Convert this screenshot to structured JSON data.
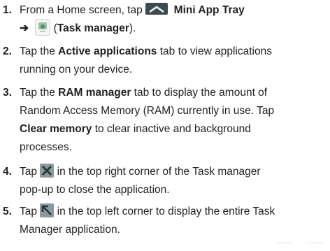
{
  "steps": [
    {
      "number": "1.",
      "line1_before": "From a Home screen, tap ",
      "line1_bold": "Mini App Tray",
      "line2_arrow": "➔",
      "line2_paren_open": " (",
      "line2_bold": "Task manager",
      "line2_paren_close": ")."
    },
    {
      "number": "2.",
      "line1_before": "Tap the ",
      "line1_bold": "Active applications",
      "line1_after": " tab to view applications",
      "line2": "running on your device."
    },
    {
      "number": "3.",
      "line1_before": "Tap the ",
      "line1_bold": "RAM manager",
      "line1_after": " tab to display the amount of",
      "line2": "Random Access Memory (RAM) currently in use. Tap",
      "line3_bold": "Clear memory",
      "line3_after": " to clear inactive and background",
      "line4": "processes."
    },
    {
      "number": "4.",
      "line1_before": "Tap ",
      "line1_after": " in the top right corner of the Task manager",
      "line2": "pop-up to close the application."
    },
    {
      "number": "5.",
      "line1_before": "Tap ",
      "line1_after": " in the top left corner to display the entire Task",
      "line2": "Manager application."
    }
  ],
  "icons": {
    "mini_app_tray": "chevron-up-tab-icon",
    "task_manager": "task-manager-app-icon",
    "close": "close-x-icon",
    "expand": "top-left-corner-arrow-icon"
  },
  "colors": {
    "text": "#231f20",
    "tray_icon_bg": "#3b4a4f",
    "button_icon_bg": "#8a9a9e"
  }
}
